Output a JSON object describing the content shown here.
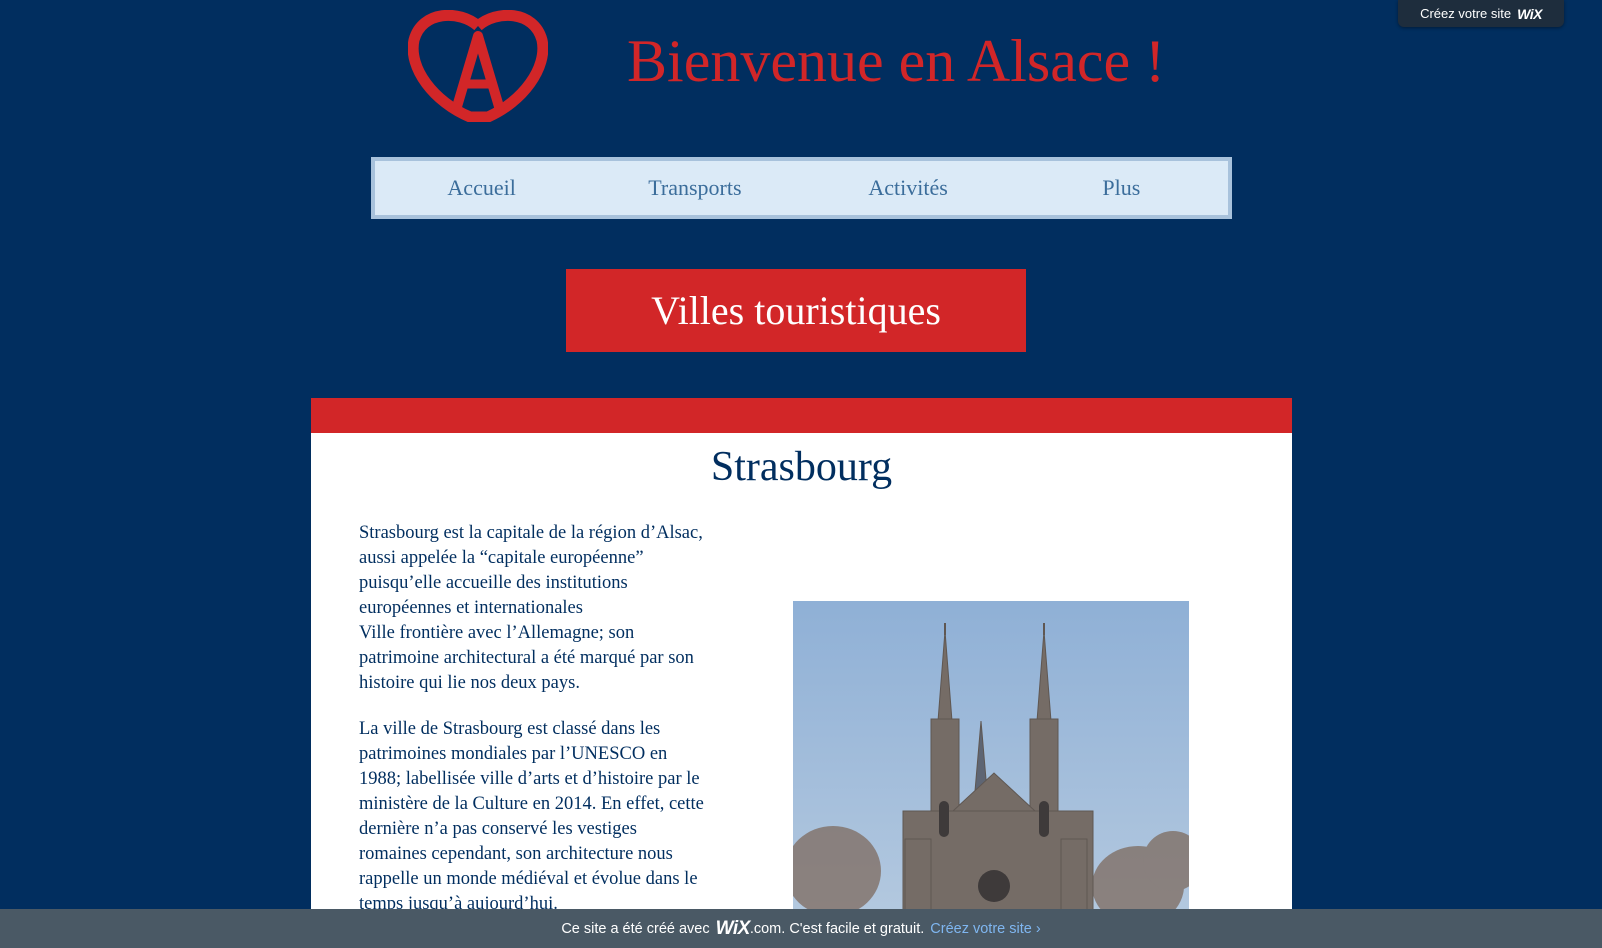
{
  "header": {
    "logo_icon": "alsace-logo-icon",
    "title": "Bienvenue en Alsace !",
    "accent_color": "#d22628"
  },
  "wix_top": {
    "label": "Créez votre site",
    "brand": "WiX"
  },
  "nav": {
    "items": [
      {
        "label": "Accueil"
      },
      {
        "label": "Transports"
      },
      {
        "label": "Activités"
      },
      {
        "label": "Plus"
      }
    ]
  },
  "hero": {
    "button_label": "Villes touristiques"
  },
  "city": {
    "name": "Strasbourg",
    "paragraph_1": "Strasbourg est la capitale de la région d’Alsac, aussi appelée la “capitale européenne” puisqu’elle accueille des institutions européennes et internationales",
    "paragraph_2": "Ville frontière avec l’Allemagne; son patrimoine architectural a été marqué par son histoire qui lie nos deux pays.",
    "paragraph_3": "La ville de Strasbourg est classé dans les patrimoines mondiales par l’UNESCO en 1988; labellisée ville d’arts et d’histoire par le ministère de la Culture en 2014. En effet, cette dernière n’a pas conservé les vestiges romaines cependant, son architecture nous rappelle un monde médiéval et évolue dans le temps jusqu’à aujourd’hui."
  },
  "footer": {
    "prefix": "Ce site a été créé avec",
    "brand": "WiX",
    "suffix": ".com. C'est facile et gratuit.",
    "link": "Créez votre site ›"
  },
  "colors": {
    "background": "#012e5f",
    "red": "#d22628",
    "nav_bg": "#dbeaf7",
    "nav_text": "#3b6d9b",
    "footer_bg": "#4a5965",
    "footer_link": "#7fb6f0"
  }
}
